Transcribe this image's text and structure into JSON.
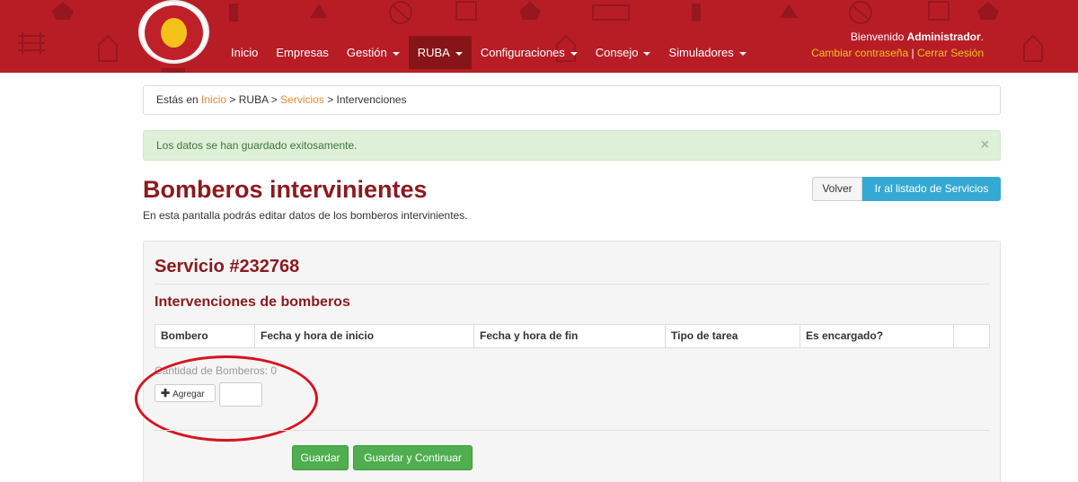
{
  "header": {
    "nav": [
      {
        "label": "Inicio",
        "has_caret": false
      },
      {
        "label": "Empresas",
        "has_caret": false
      },
      {
        "label": "Gestión",
        "has_caret": true
      },
      {
        "label": "RUBA",
        "has_caret": true,
        "active": true
      },
      {
        "label": "Configuraciones",
        "has_caret": true
      },
      {
        "label": "Consejo",
        "has_caret": true
      },
      {
        "label": "Simuladores",
        "has_caret": true
      }
    ],
    "welcome_prefix": "Bienvenido",
    "user_name": "Administrador",
    "change_password": "Cambiar contraseña",
    "separator": "|",
    "logout": "Cerrar Sesión",
    "colors": {
      "bar": "#b81d26",
      "active_nav": "#871419",
      "link": "#f5c21a"
    }
  },
  "breadcrumb": {
    "prefix": "Estás en",
    "items": [
      "Inicio",
      "RUBA",
      "Servicios",
      "Intervenciones"
    ],
    "sep": ">"
  },
  "alert": {
    "message": "Los datos se han guardado exitosamente.",
    "close": "×"
  },
  "page": {
    "title": "Bomberos intervinientes",
    "subtitle": "En esta pantalla podrás editar datos de los bomberos intervinientes.",
    "back_button": "Volver",
    "list_button": "Ir al listado de Servicios"
  },
  "panel": {
    "service_title": "Servicio #232768",
    "section_title": "Intervenciones de bomberos",
    "columns": [
      "Bombero",
      "Fecha y hora de inicio",
      "Fecha y hora de fin",
      "Tipo de tarea",
      "Es encargado?",
      ""
    ],
    "count_label": "Cantidad de Bomberos: 0",
    "add_button": "Agregar",
    "add_icon": "plus-icon",
    "save_button": "Guardar",
    "save_continue_button": "Guardar y Continuar"
  }
}
